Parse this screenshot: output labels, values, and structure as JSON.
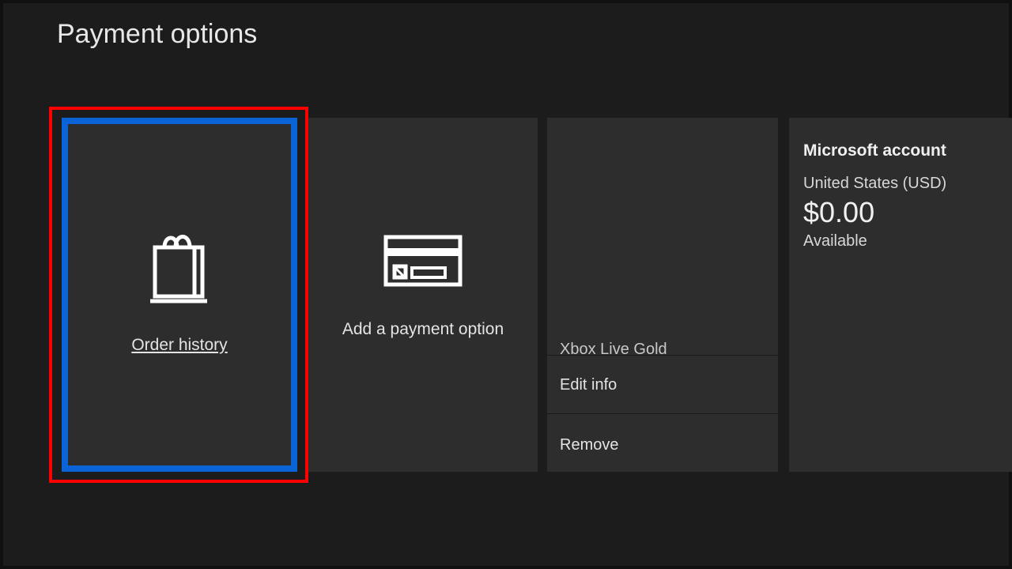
{
  "page_title": "Payment options",
  "tiles": {
    "order_history": {
      "label": "Order history",
      "icon": "shopping-bag"
    },
    "add_payment": {
      "label": "Add a payment option",
      "icon": "credit-card"
    },
    "subscription": {
      "name": "Xbox Live Gold",
      "actions": {
        "edit": "Edit info",
        "remove": "Remove"
      }
    },
    "account": {
      "title": "Microsoft account",
      "region": "United States (USD)",
      "balance": "$0.00",
      "available_label": "Available"
    }
  },
  "colors": {
    "selection": "#0a64d8",
    "highlight": "#ff0000",
    "tile_bg": "#2d2d2d",
    "page_bg": "#1c1c1c"
  }
}
